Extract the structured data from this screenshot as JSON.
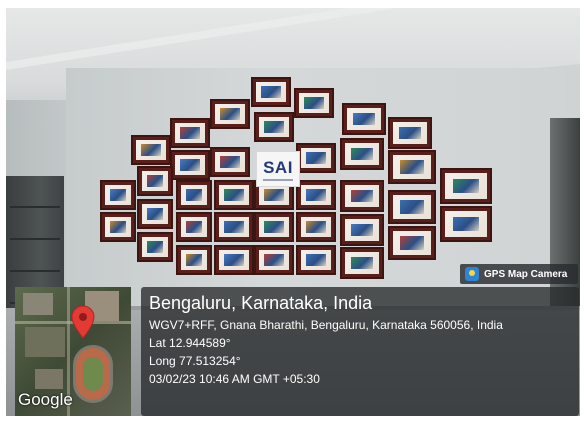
{
  "badge": {
    "label": "GPS Map Camera",
    "icon": "gps-map-camera-icon"
  },
  "map": {
    "provider_label": "Google",
    "pin_icon": "location-pin-icon",
    "pin_color": "#e53935"
  },
  "location": {
    "title": "Bengaluru, Karnataka, India",
    "address": "WGV7+RFF, Gnana Bharathi, Bengaluru, Karnataka 560056, India",
    "latitude": "Lat 12.944589°",
    "longitude": "Long 77.513254°",
    "timestamp": "03/02/23 10:46 AM GMT +05:30"
  },
  "wall_display": {
    "logo_text": "SAI",
    "frame_color": "#5a1f1a"
  }
}
